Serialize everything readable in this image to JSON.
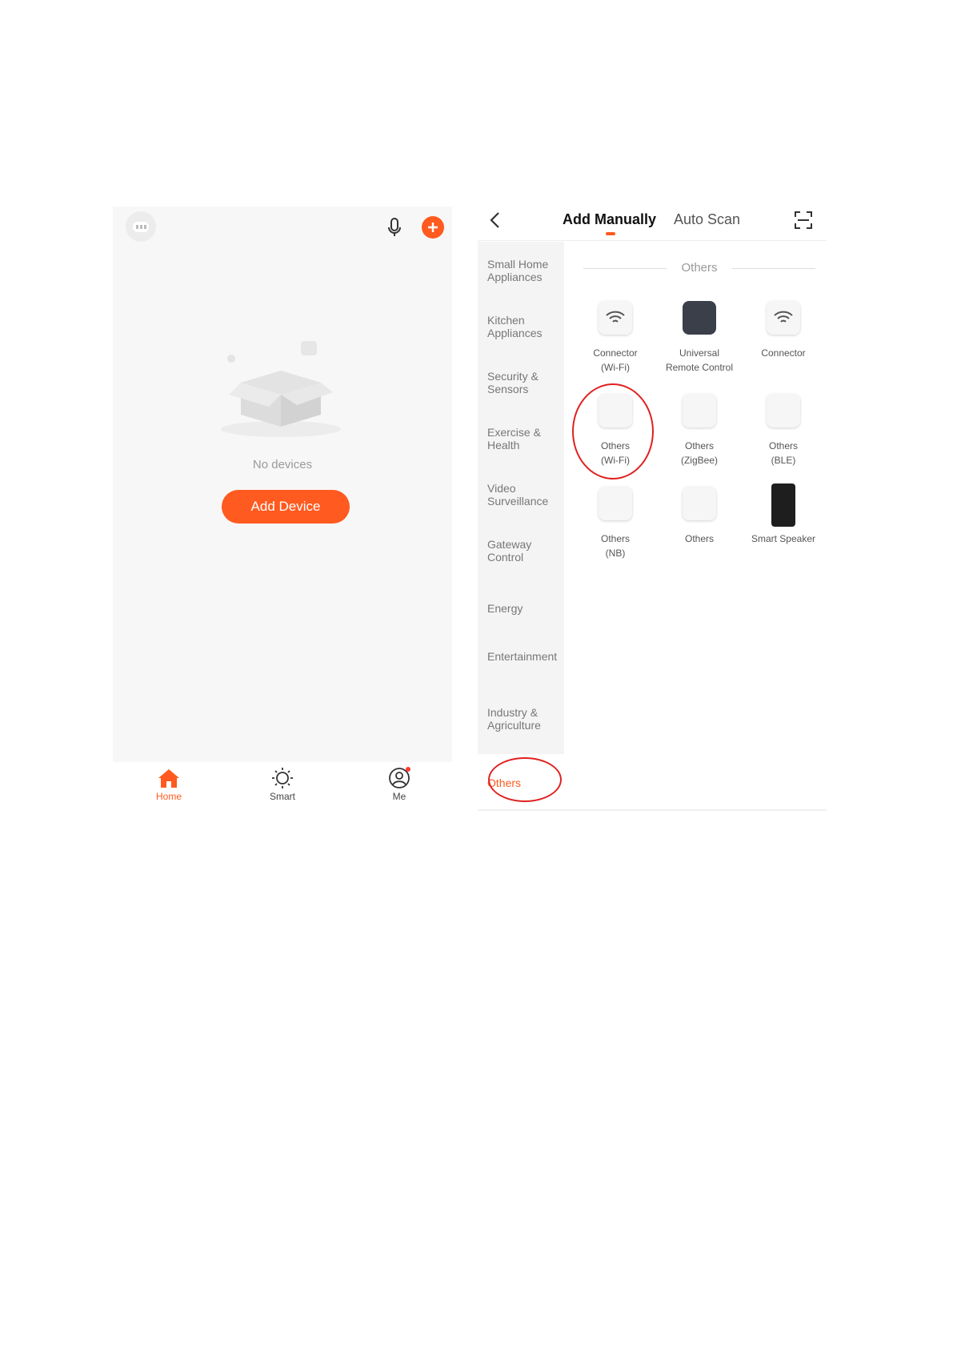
{
  "left_screen": {
    "no_devices_text": "No devices",
    "add_device_label": "Add Device",
    "nav": [
      {
        "label": "Home",
        "icon": "home-icon",
        "active": true
      },
      {
        "label": "Smart",
        "icon": "sun-icon",
        "active": false
      },
      {
        "label": "Me",
        "icon": "profile-icon",
        "active": false
      }
    ]
  },
  "right_screen": {
    "tabs": {
      "add_manually": "Add Manually",
      "auto_scan": "Auto Scan"
    },
    "categories": [
      "Small Home Appliances",
      "Kitchen Appliances",
      "Security & Sensors",
      "Exercise & Health",
      "Video Surveillance",
      "Gateway Control",
      "Energy",
      "Entertainment",
      "Industry & Agriculture"
    ],
    "selected_category": "Others",
    "section_title": "Others",
    "devices": [
      {
        "name_line1": "Connector",
        "name_line2": "(Wi-Fi)",
        "icon": "wifi-icon"
      },
      {
        "name_line1": "Universal",
        "name_line2": "Remote Control",
        "icon": "remote-icon"
      },
      {
        "name_line1": "Connector",
        "name_line2": "",
        "icon": "wifi-icon"
      },
      {
        "name_line1": "Others",
        "name_line2": "(Wi-Fi)",
        "icon": "device-icon"
      },
      {
        "name_line1": "Others",
        "name_line2": "(ZigBee)",
        "icon": "device-icon"
      },
      {
        "name_line1": "Others",
        "name_line2": "(BLE)",
        "icon": "device-icon"
      },
      {
        "name_line1": "Others",
        "name_line2": "(NB)",
        "icon": "device-icon"
      },
      {
        "name_line1": "Others",
        "name_line2": "",
        "icon": "device-icon"
      },
      {
        "name_line1": "Smart Speaker",
        "name_line2": "",
        "icon": "speaker-icon"
      }
    ]
  },
  "colors": {
    "accent": "#ff5a1f",
    "annotation": "#e02020"
  }
}
